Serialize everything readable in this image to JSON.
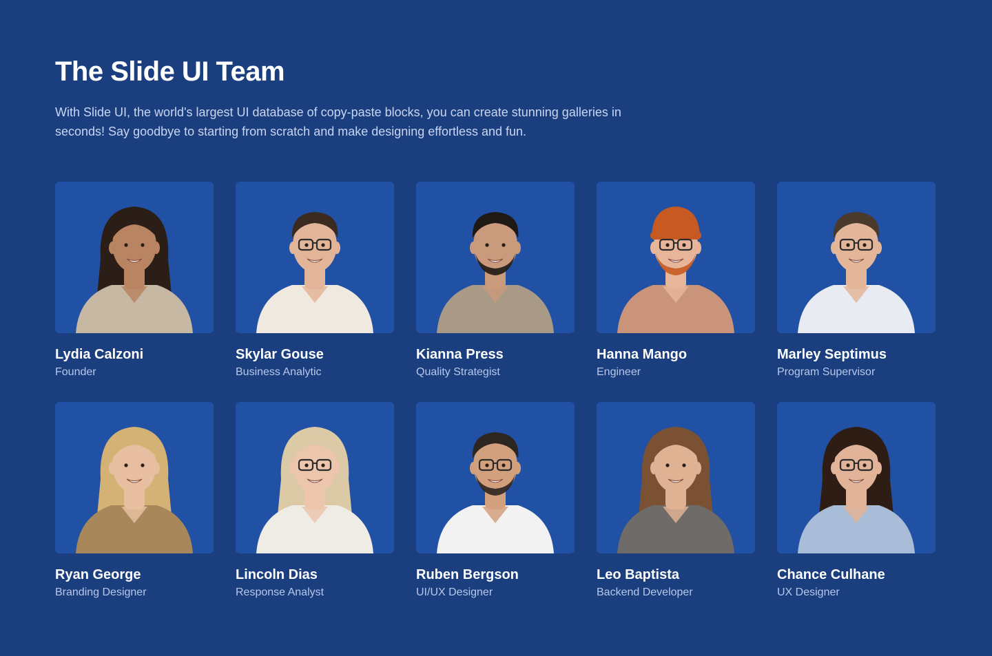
{
  "header": {
    "title": "The Slide UI Team",
    "description": "With Slide UI, the world's largest UI database of copy-paste blocks, you can create stunning galleries in seconds! Say goodbye to starting from scratch and make designing effortless and fun."
  },
  "colors": {
    "background": "#1a3e7e",
    "card": "#2151a4",
    "role_text": "#b8c8ec",
    "description_text": "#c9d6f3"
  },
  "team": [
    {
      "name": "Lydia Calzoni",
      "role": "Founder",
      "photo": {
        "icon": "woman-portrait-icon",
        "skin": "#b98462",
        "hair": "#2a1e17",
        "shirt": "#c7b8a4",
        "long_hair": true,
        "glasses": false,
        "hat": false,
        "beard": false
      }
    },
    {
      "name": "Skylar Gouse",
      "role": "Business Analytic",
      "photo": {
        "icon": "man-portrait-icon",
        "skin": "#e2b598",
        "hair": "#3a2a20",
        "shirt": "#efe9df",
        "long_hair": false,
        "glasses": true,
        "hat": false,
        "beard": false
      }
    },
    {
      "name": "Kianna Press",
      "role": "Quality Strategist",
      "photo": {
        "icon": "man-portrait-icon",
        "skin": "#c99a7c",
        "hair": "#1f1915",
        "shirt": "#a89a86",
        "long_hair": false,
        "glasses": false,
        "hat": false,
        "beard": true
      }
    },
    {
      "name": "Hanna Mango",
      "role": "Engineer",
      "photo": {
        "icon": "man-portrait-icon",
        "skin": "#e7b59a",
        "hair": "#c75a22",
        "shirt": "#c99479",
        "long_hair": false,
        "glasses": true,
        "hat": true,
        "beard": true
      }
    },
    {
      "name": "Marley Septimus",
      "role": "Program Supervisor",
      "photo": {
        "icon": "man-portrait-icon",
        "skin": "#e3b699",
        "hair": "#4a3a2c",
        "shirt": "#e8ecf2",
        "long_hair": false,
        "glasses": true,
        "hat": false,
        "beard": false
      }
    },
    {
      "name": "Ryan George",
      "role": "Branding Designer",
      "photo": {
        "icon": "woman-portrait-icon",
        "skin": "#e7bfa0",
        "hair": "#d4b276",
        "shirt": "#a8875b",
        "long_hair": true,
        "glasses": false,
        "hat": false,
        "beard": false
      }
    },
    {
      "name": "Lincoln Dias",
      "role": "Response Analyst",
      "photo": {
        "icon": "woman-portrait-icon",
        "skin": "#ebc6ad",
        "hair": "#dcc9a6",
        "shirt": "#efece6",
        "long_hair": true,
        "glasses": true,
        "hat": false,
        "beard": false
      }
    },
    {
      "name": "Ruben Bergson",
      "role": "UI/UX Designer",
      "photo": {
        "icon": "man-portrait-icon",
        "skin": "#d3a07e",
        "hair": "#2d2520",
        "shirt": "#f2f2f2",
        "long_hair": false,
        "glasses": true,
        "hat": false,
        "beard": true
      }
    },
    {
      "name": "Leo Baptista",
      "role": "Backend Developer",
      "photo": {
        "icon": "woman-portrait-icon",
        "skin": "#e0b294",
        "hair": "#7a5233",
        "shirt": "#6f6b68",
        "long_hair": true,
        "glasses": false,
        "hat": false,
        "beard": false
      }
    },
    {
      "name": "Chance Culhane",
      "role": "UX Designer",
      "photo": {
        "icon": "woman-portrait-icon",
        "skin": "#e1b398",
        "hair": "#2e1d15",
        "shirt": "#a9bcd8",
        "long_hair": true,
        "glasses": true,
        "hat": false,
        "beard": false
      }
    }
  ]
}
